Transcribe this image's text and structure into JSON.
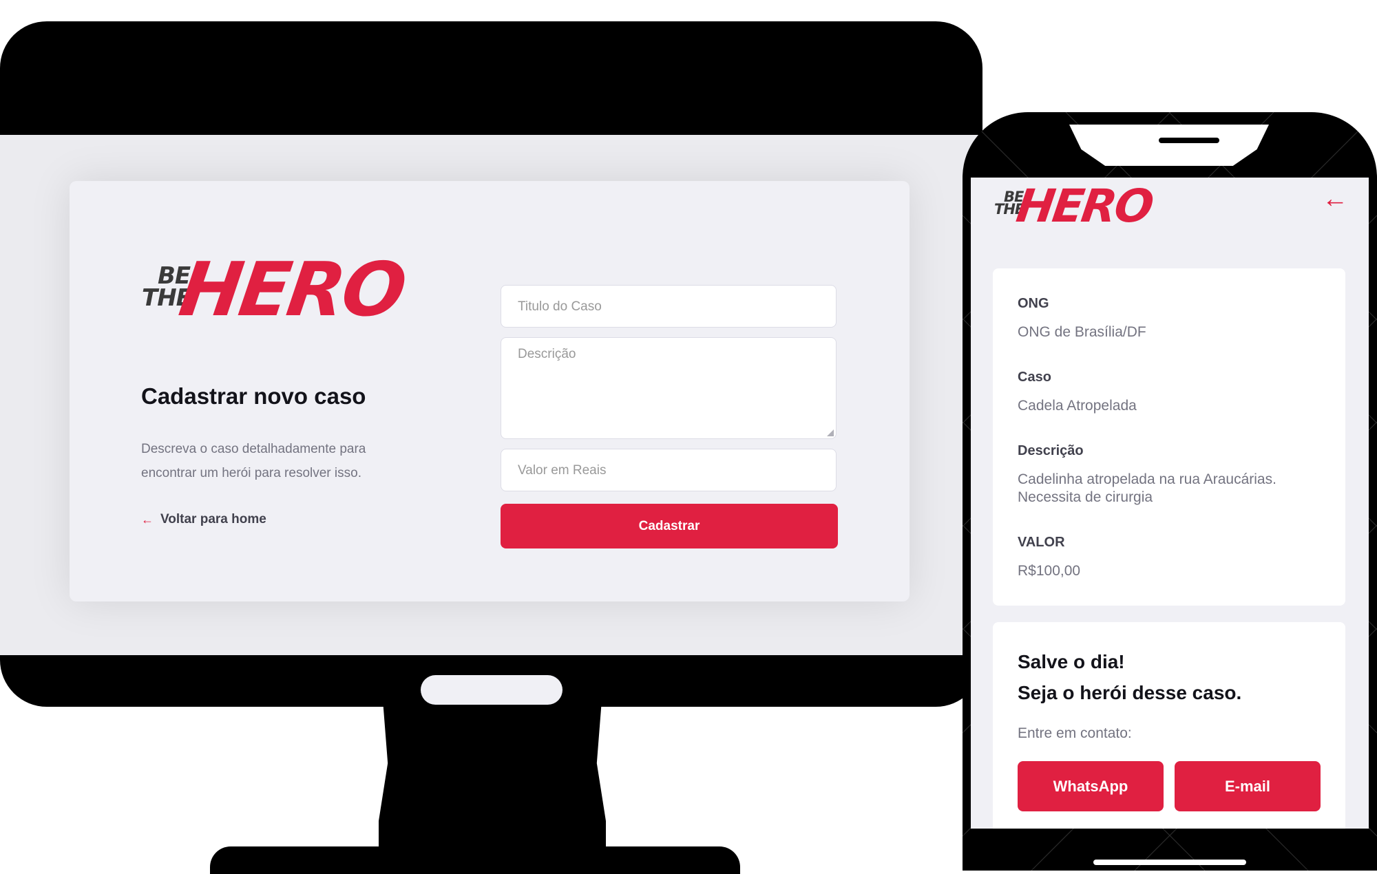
{
  "brand": {
    "be": "BE",
    "the": "THE",
    "hero": "HERO",
    "accent_color": "#e02041"
  },
  "desktop": {
    "title": "Cadastrar novo caso",
    "description": "Descreva o caso detalhadamente para encontrar um herói para resolver isso.",
    "back_link": "Voltar para home",
    "back_icon": "arrow-left-icon",
    "form": {
      "title_placeholder": "Titulo do Caso",
      "description_placeholder": "Descrição",
      "value_placeholder": "Valor em Reais",
      "submit_label": "Cadastrar"
    }
  },
  "mobile": {
    "back_icon": "arrow-left-icon",
    "details": {
      "ong_label": "ONG",
      "ong_value": "ONG de Brasília/DF",
      "case_label": "Caso",
      "case_value": "Cadela Atropelada",
      "description_label": "Descrição",
      "description_value": "Cadelinha atropelada na rua Araucárias. Necessita de cirurgia",
      "value_label": "VALOR",
      "value_value": "R$100,00"
    },
    "contact": {
      "headline_1": "Salve o dia!",
      "headline_2": "Seja o herói desse caso.",
      "prompt": "Entre em contato:",
      "whatsapp_label": "WhatsApp",
      "email_label": "E-mail"
    }
  }
}
